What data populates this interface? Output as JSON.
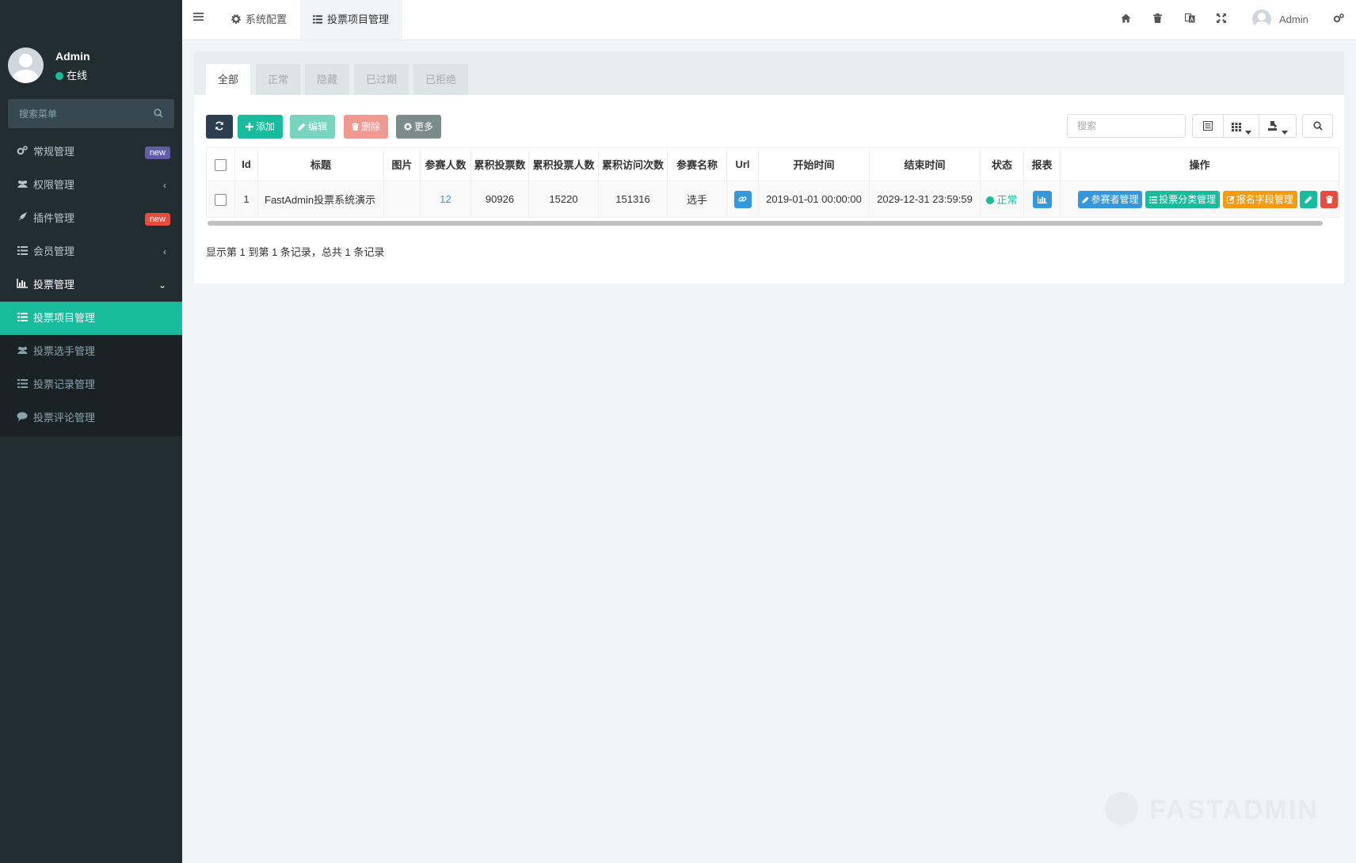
{
  "sidebar": {
    "user": {
      "name": "Admin",
      "status": "在线"
    },
    "search_placeholder": "搜索菜单",
    "menu": [
      {
        "icon": "cogs-icon",
        "label": "常规管理",
        "badge": "new",
        "badge_color": "#605ca8"
      },
      {
        "icon": "users-icon",
        "label": "权限管理",
        "chevron": "‹"
      },
      {
        "icon": "rocket-icon",
        "label": "插件管理",
        "badge": "new",
        "badge_color": "#e74c3c"
      },
      {
        "icon": "list-icon",
        "label": "会员管理",
        "chevron": "‹"
      },
      {
        "icon": "bar-chart-icon",
        "label": "投票管理",
        "chevron": "⌄"
      }
    ],
    "submenu": [
      {
        "icon": "list-icon",
        "label": "投票项目管理",
        "active": true
      },
      {
        "icon": "users-icon",
        "label": "投票选手管理"
      },
      {
        "icon": "list-icon",
        "label": "投票记录管理"
      },
      {
        "icon": "comment-icon",
        "label": "投票评论管理"
      }
    ]
  },
  "topbar": {
    "tabs": [
      {
        "icon": "gear-icon",
        "label": "系统配置"
      },
      {
        "icon": "list-icon",
        "label": "投票项目管理",
        "active": true
      }
    ],
    "icons": [
      "home-icon",
      "trash-icon",
      "language-icon",
      "fullscreen-icon",
      "settings-icon"
    ],
    "user": "Admin"
  },
  "filter_tabs": [
    "全部",
    "正常",
    "隐藏",
    "已过期",
    "已拒绝"
  ],
  "toolbar": {
    "refresh": "",
    "add": "添加",
    "edit": "编辑",
    "delete": "删除",
    "more": "更多",
    "search_placeholder": "搜索"
  },
  "table": {
    "columns": [
      "Id",
      "标题",
      "图片",
      "参赛人数",
      "累积投票数",
      "累积投票人数",
      "累积访问次数",
      "参赛名称",
      "Url",
      "开始时间",
      "结束时间",
      "状态",
      "报表",
      "操作"
    ],
    "rows": [
      {
        "id": "1",
        "title": "FastAdmin投票系统演示",
        "image": "",
        "players": "12",
        "votes": "90926",
        "voters": "15220",
        "visits": "151316",
        "player_name": "选手",
        "start": "2019-01-01 00:00:00",
        "end": "2029-12-31 23:59:59",
        "status": "正常",
        "actions": [
          "参赛者管理",
          "投票分类管理",
          "报名字段管理"
        ]
      }
    ]
  },
  "pagination_info": "显示第 1 到第 1 条记录，总共 1 条记录",
  "watermark": "FASTADMIN",
  "colors": {
    "sidebar_bg": "#222d32",
    "accent": "#18bc9c",
    "primary": "#3498db",
    "warning": "#f39c12",
    "danger": "#e74c3c",
    "dark": "#2c3e50",
    "gray": "#95a5a6"
  }
}
